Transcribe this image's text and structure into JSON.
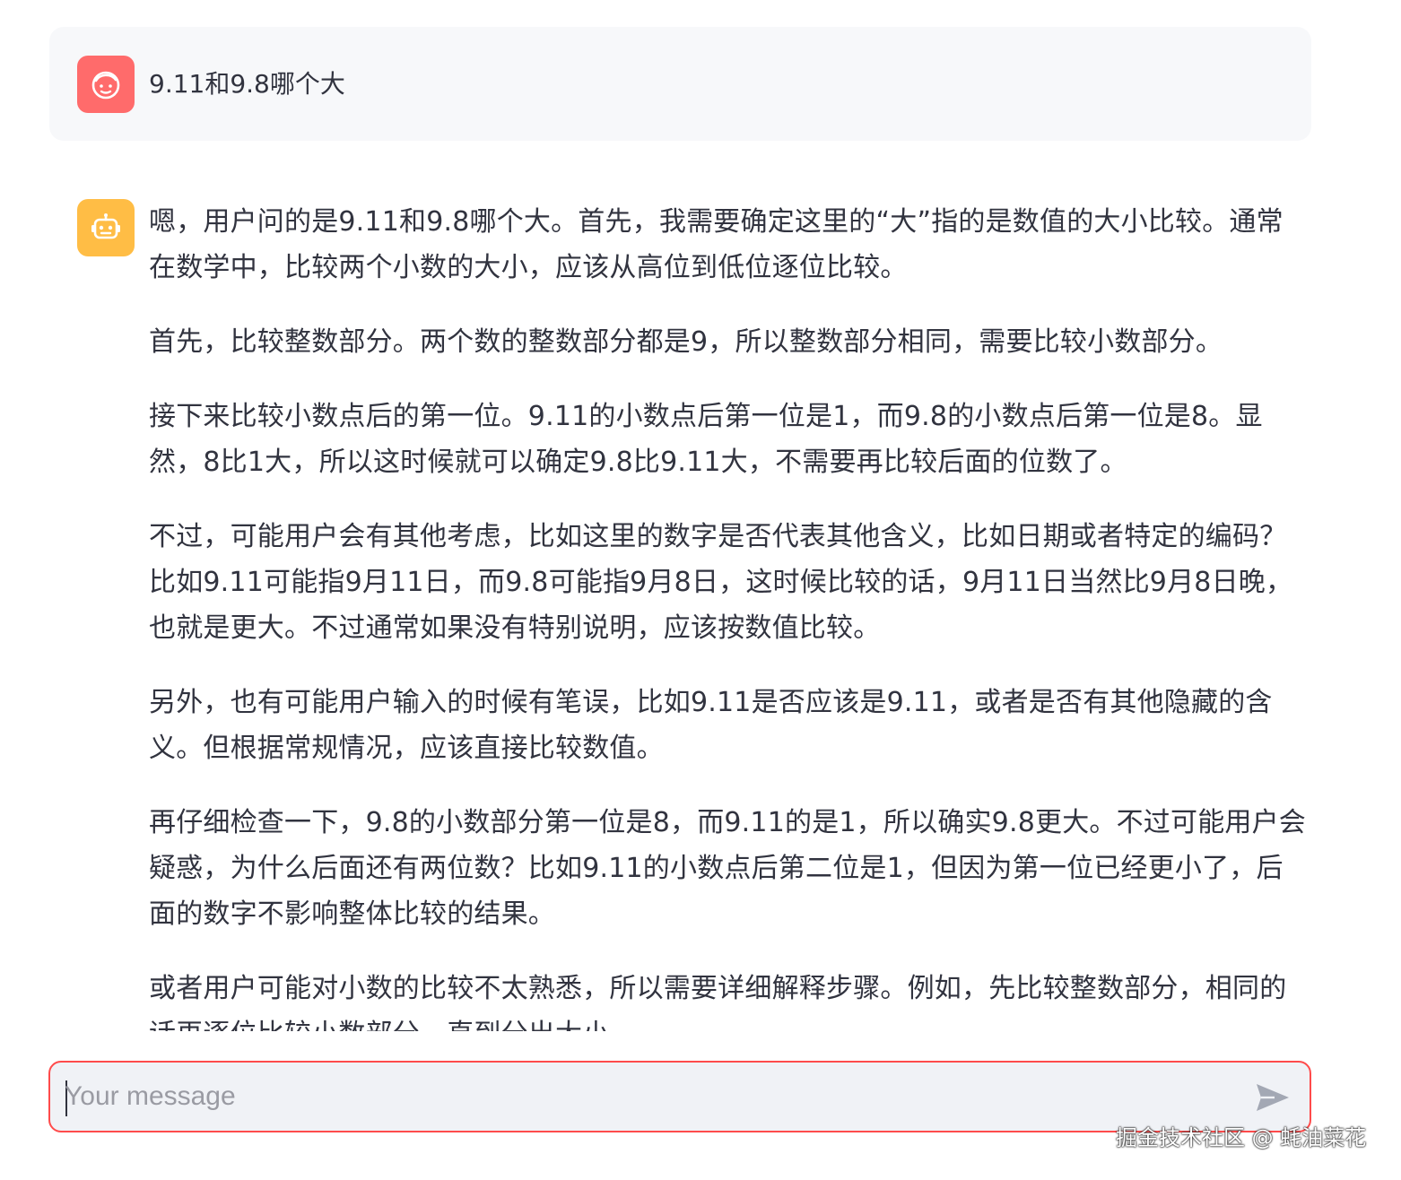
{
  "user_message": {
    "avatar_icon": "smiley-face-icon",
    "avatar_color": "#ff6b6b",
    "text": "9.11和9.8哪个大"
  },
  "assistant_message": {
    "avatar_icon": "robot-icon",
    "avatar_color": "#ffbd45",
    "paragraphs": [
      "嗯，用户问的是9.11和9.8哪个大。首先，我需要确定这里的“大”指的是数值的大小比较。通常在数学中，比较两个小数的大小，应该从高位到低位逐位比较。",
      "首先，比较整数部分。两个数的整数部分都是9，所以整数部分相同，需要比较小数部分。",
      "接下来比较小数点后的第一位。9.11的小数点后第一位是1，而9.8的小数点后第一位是8。显然，8比1大，所以这时候就可以确定9.8比9.11大，不需要再比较后面的位数了。",
      "不过，可能用户会有其他考虑，比如这里的数字是否代表其他含义，比如日期或者特定的编码？比如9.11可能指9月11日，而9.8可能指9月8日，这时候比较的话，9月11日当然比9月8日晚，也就是更大。不过通常如果没有特别说明，应该按数值比较。",
      "另外，也有可能用户输入的时候有笔误，比如9.11是否应该是9.11，或者是否有其他隐藏的含义。但根据常规情况，应该直接比较数值。",
      "再仔细检查一下，9.8的小数部分第一位是8，而9.11的是1，所以确实9.8更大。不过可能用户会疑惑，为什么后面还有两位数？比如9.11的小数点后第二位是1，但因为第一位已经更小了，后面的数字不影响整体比较的结果。",
      "或者用户可能对小数的比较不太熟悉，所以需要详细解释步骤。例如，先比较整数部分，相同的话再逐位比较小数部分，直到分出大小。"
    ]
  },
  "composer": {
    "placeholder": "Your message",
    "value": "",
    "border_color": "#ff4b4b",
    "send_icon": "send-arrow-icon"
  },
  "watermark": "掘金技术社区 @ 蚝油菜花"
}
